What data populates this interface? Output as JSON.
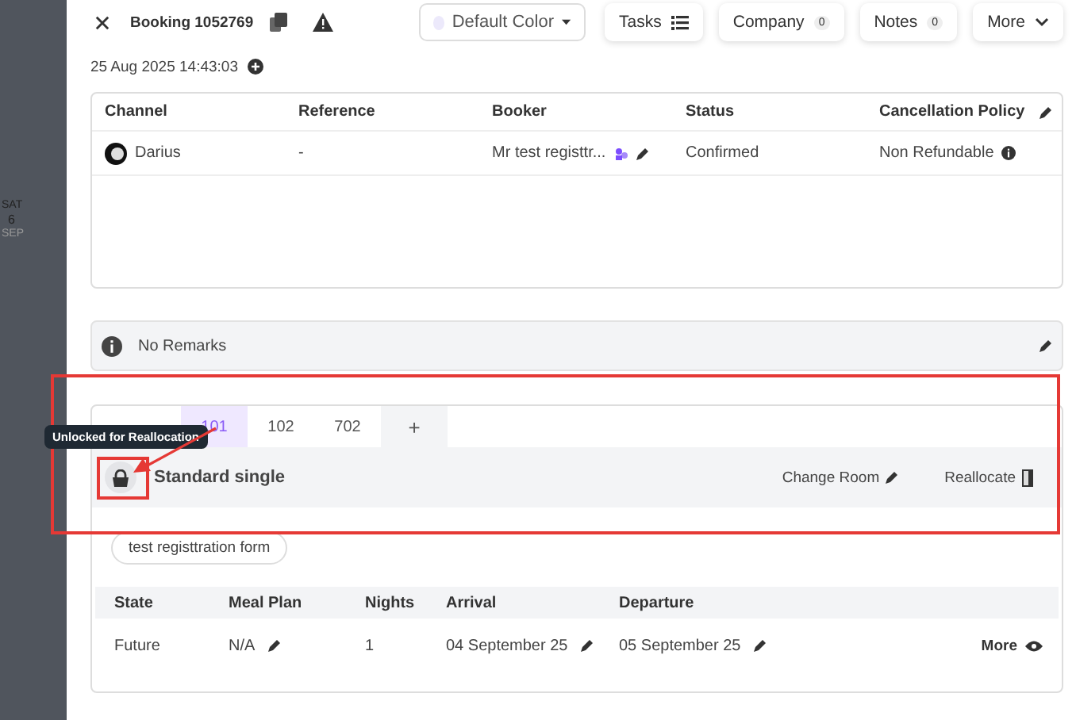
{
  "calendar_strip": {
    "weekday": "SAT",
    "day": "6",
    "month": "SEP"
  },
  "header": {
    "title": "Booking 1052769",
    "color_dropdown": "Default Color",
    "buttons": [
      {
        "label": "Tasks",
        "kind": "icon"
      },
      {
        "label": "Company",
        "kind": "count",
        "count": "0"
      },
      {
        "label": "Notes",
        "kind": "count",
        "count": "0"
      },
      {
        "label": "More",
        "kind": "caret"
      }
    ]
  },
  "created": "25 Aug 2025 14:43:03",
  "booking_table": {
    "columns": [
      "Channel",
      "Reference",
      "Booker",
      "Status",
      "Cancellation Policy"
    ],
    "row": {
      "channel": "Darius",
      "reference": "-",
      "booker": "Mr test registtr...",
      "status": "Confirmed",
      "policy": "Non Refundable"
    }
  },
  "remarks": "No Remarks",
  "rooms": {
    "tabs": [
      {
        "label": "101",
        "selected": true
      },
      {
        "label": "102",
        "selected": false
      },
      {
        "label": "702",
        "selected": false
      }
    ],
    "add_tab": "+",
    "room_name": "Standard single",
    "actions": [
      "Change Room",
      "Reallocate"
    ],
    "tooltip": "Unlocked for Reallocation",
    "form_chip": "test registtration form",
    "columns": [
      "State",
      "Meal Plan",
      "Nights",
      "Arrival",
      "Departure"
    ],
    "row": [
      {
        "text": "Future",
        "editable": false
      },
      {
        "text": "N/A",
        "editable": true
      },
      {
        "text": "1",
        "editable": false
      },
      {
        "text": "04 September 25",
        "editable": true
      },
      {
        "text": "05 September 25",
        "editable": true
      }
    ],
    "more": "More"
  }
}
